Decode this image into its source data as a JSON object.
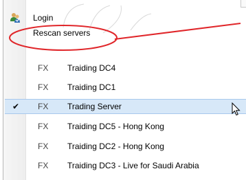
{
  "menu": {
    "login_label": "Login",
    "rescan_label": "Rescan servers",
    "servers": [
      {
        "prefix": "FX",
        "name": "Traiding DC4",
        "selected": false
      },
      {
        "prefix": "FX",
        "name": "Traiding DC1",
        "selected": false
      },
      {
        "prefix": "FX",
        "name": "Trading Server",
        "selected": true
      },
      {
        "prefix": "FX",
        "name": "Traiding DC5 - Hong Kong",
        "selected": false
      },
      {
        "prefix": "FX",
        "name": "Traiding DC2 - Hong Kong",
        "selected": false
      },
      {
        "prefix": "FX",
        "name": "Traiding DC3 - Live for Saudi Arabia",
        "selected": false
      }
    ]
  },
  "icons": {
    "login": "users-login-icon",
    "selected": "checkmark-icon",
    "pointer": "mouse-cursor-icon"
  },
  "colors": {
    "annotation": "#e0262a",
    "selection_bg": "#d7e8f8",
    "selection_border": "#a8c8ec",
    "gutter": "#f2f2f2"
  }
}
